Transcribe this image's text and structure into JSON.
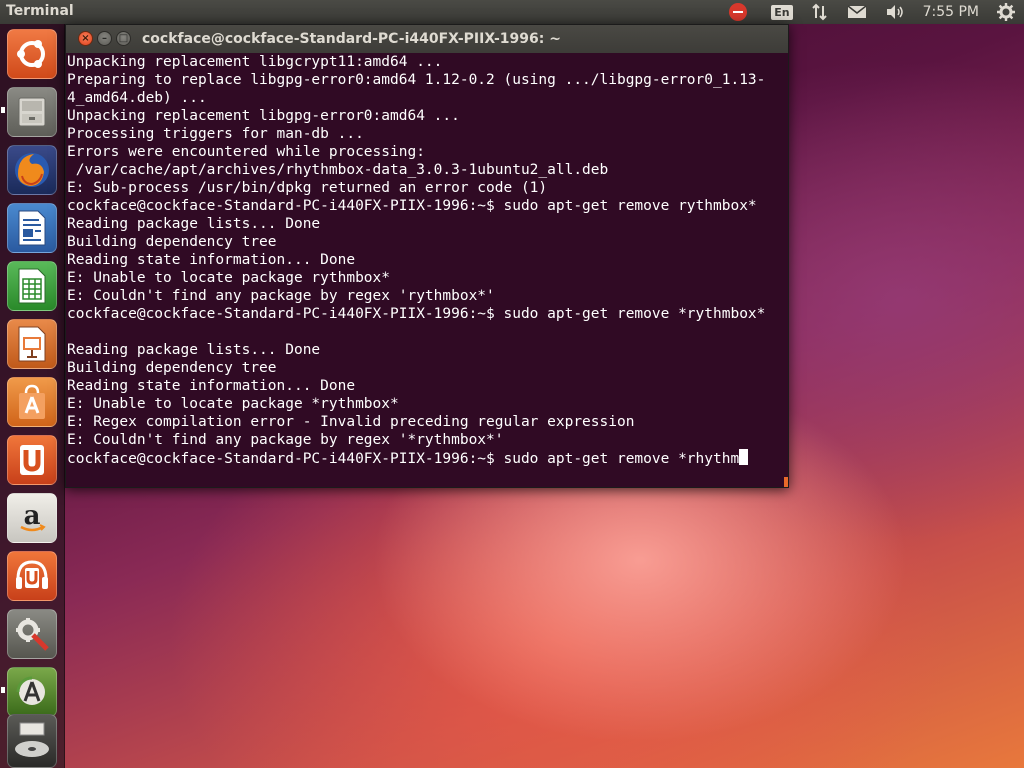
{
  "top_panel": {
    "app_title": "Terminal",
    "language": "En",
    "clock": "7:55 PM"
  },
  "launcher": {
    "items": [
      {
        "name": "ubuntu-dash",
        "icon": "ubuntu-logo-icon",
        "color": "#e85d2c"
      },
      {
        "name": "files",
        "icon": "file-cabinet-icon",
        "color": "#9a9a92"
      },
      {
        "name": "firefox",
        "icon": "firefox-icon",
        "color": "#e8761c"
      },
      {
        "name": "libreoffice-writer",
        "icon": "writer-document-icon",
        "color": "#2a6fb0"
      },
      {
        "name": "libreoffice-calc",
        "icon": "calc-spreadsheet-icon",
        "color": "#3a9a3a"
      },
      {
        "name": "libreoffice-impress",
        "icon": "impress-presentation-icon",
        "color": "#c85a1e"
      },
      {
        "name": "software-center",
        "icon": "shopping-bag-icon",
        "color": "#e8762a"
      },
      {
        "name": "ubuntu-one",
        "icon": "ubuntu-one-icon",
        "color": "#d84a1e"
      },
      {
        "name": "amazon",
        "icon": "amazon-icon",
        "color": "#d8d8d4"
      },
      {
        "name": "ubuntu-one-music",
        "icon": "music-headphones-icon",
        "color": "#d8501e"
      },
      {
        "name": "system-settings",
        "icon": "settings-wrench-icon",
        "color": "#7a7a76"
      },
      {
        "name": "software-updater",
        "icon": "updater-icon",
        "color": "#5a9a3a"
      },
      {
        "name": "dvd",
        "icon": "dvd-icon",
        "label": "DVD",
        "color": "#cfcfcf"
      }
    ]
  },
  "terminal": {
    "title": "cockface@cockface-Standard-PC-i440FX-PIIX-1996: ~",
    "lines": [
      "Unpacking replacement libgcrypt11:amd64 ...",
      "Preparing to replace libgpg-error0:amd64 1.12-0.2 (using .../libgpg-error0_1.13-",
      "4_amd64.deb) ...",
      "Unpacking replacement libgpg-error0:amd64 ...",
      "Processing triggers for man-db ...",
      "Errors were encountered while processing:",
      " /var/cache/apt/archives/rhythmbox-data_3.0.3-1ubuntu2_all.deb",
      "E: Sub-process /usr/bin/dpkg returned an error code (1)",
      "cockface@cockface-Standard-PC-i440FX-PIIX-1996:~$ sudo apt-get remove rythmbox*",
      "Reading package lists... Done",
      "Building dependency tree",
      "Reading state information... Done",
      "E: Unable to locate package rythmbox*",
      "E: Couldn't find any package by regex 'rythmbox*'",
      "cockface@cockface-Standard-PC-i440FX-PIIX-1996:~$ sudo apt-get remove *rythmbox*",
      "",
      "Reading package lists... Done",
      "Building dependency tree",
      "Reading state information... Done",
      "E: Unable to locate package *rythmbox*",
      "E: Regex compilation error - Invalid preceding regular expression",
      "E: Couldn't find any package by regex '*rythmbox*'"
    ],
    "prompt_line": "cockface@cockface-Standard-PC-i440FX-PIIX-1996:~$ sudo apt-get remove *rhythm",
    "background": "#300a24",
    "foreground": "#ffffff"
  }
}
